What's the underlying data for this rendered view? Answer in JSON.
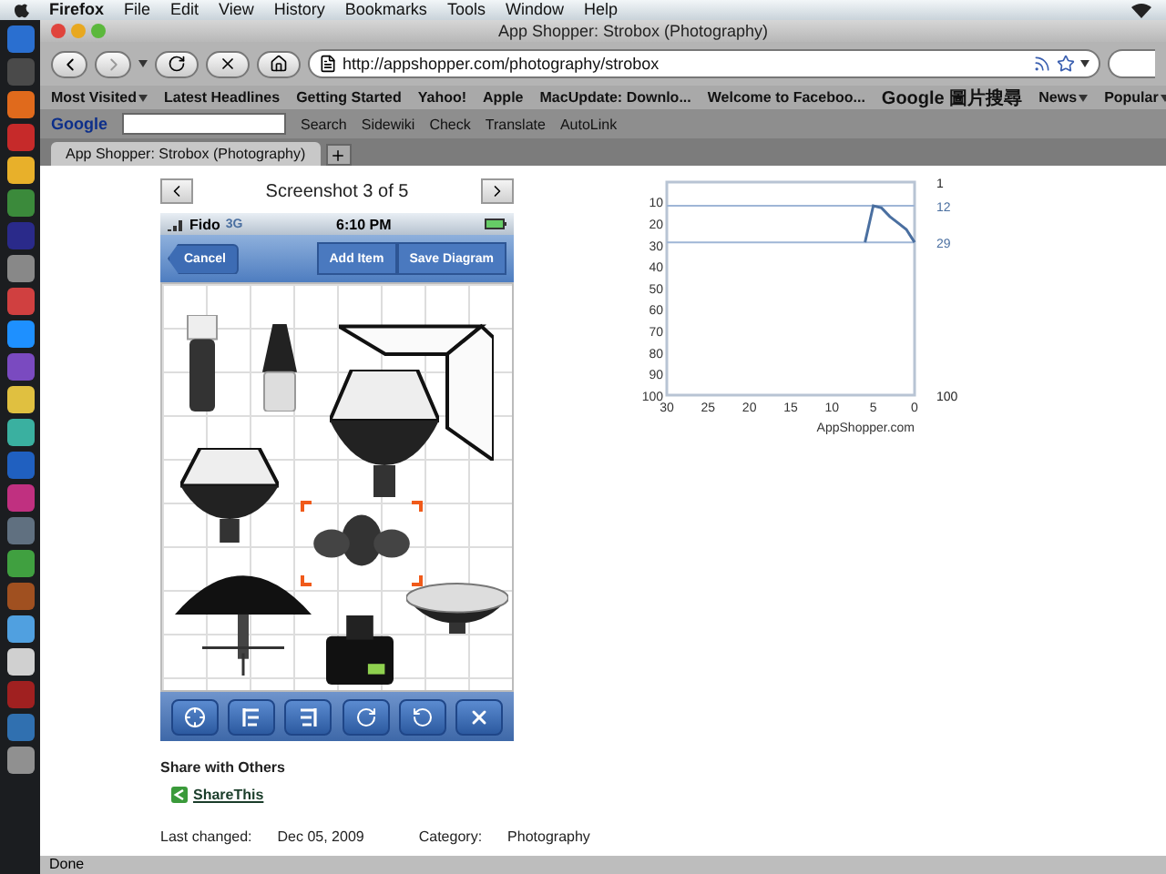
{
  "menu_bar": {
    "app": "Firefox",
    "menus": [
      "File",
      "Edit",
      "View",
      "History",
      "Bookmarks",
      "Tools",
      "Window",
      "Help"
    ]
  },
  "window": {
    "title": "App Shopper: Strobox (Photography)"
  },
  "navigation": {
    "url": "http://appshopper.com/photography/strobox"
  },
  "bookmarks": [
    {
      "label": "Most Visited",
      "has_menu": true
    },
    {
      "label": "Latest Headlines",
      "has_menu": false
    },
    {
      "label": "Getting Started",
      "has_menu": false
    },
    {
      "label": "Yahoo!",
      "has_menu": false
    },
    {
      "label": "Apple",
      "has_menu": false
    },
    {
      "label": "MacUpdate: Downlo...",
      "has_menu": false
    },
    {
      "label": "Welcome to Faceboo...",
      "has_menu": false
    },
    {
      "label": "Google 圖片搜尋",
      "has_menu": false
    },
    {
      "label": "News",
      "has_menu": true
    },
    {
      "label": "Popular",
      "has_menu": true
    }
  ],
  "google_toolbar": {
    "logo": "Google",
    "items": [
      "Search",
      "Sidewiki",
      "Check",
      "Translate",
      "AutoLink"
    ]
  },
  "tabs": [
    {
      "label": "App Shopper: Strobox (Photography)",
      "selected": true
    }
  ],
  "screenshot_viewer": {
    "caption": "Screenshot 3 of 5"
  },
  "phone": {
    "carrier": "Fido",
    "network": "3G",
    "time": "6:10 PM",
    "back_button": "Cancel",
    "actions": [
      "Add Item",
      "Save Diagram"
    ],
    "diagram_items": [
      {
        "kind": "flash",
        "selected": false
      },
      {
        "kind": "snoot",
        "selected": false
      },
      {
        "kind": "softbox",
        "selected": false
      },
      {
        "kind": "hooded-light",
        "selected": false
      },
      {
        "kind": "hooded-light",
        "selected": false
      },
      {
        "kind": "top-light",
        "selected": true
      },
      {
        "kind": "umbrella",
        "selected": false
      },
      {
        "kind": "camera",
        "selected": false
      },
      {
        "kind": "beauty-dish",
        "selected": false
      }
    ],
    "tools": [
      {
        "kind": "target"
      },
      {
        "kind": "align-right"
      },
      {
        "kind": "align-left"
      },
      {
        "kind": "rotate-right"
      },
      {
        "kind": "rotate-left"
      },
      {
        "kind": "delete"
      }
    ]
  },
  "share": {
    "heading": "Share with Others",
    "link": "ShareThis"
  },
  "details": [
    {
      "label": "Last changed:",
      "value": "Dec 05, 2009"
    },
    {
      "label": "Category:",
      "value": "Photography"
    }
  ],
  "rank_chart": {
    "right_labels": [
      "1",
      "12",
      "29",
      "100"
    ],
    "chart_data": {
      "type": "line",
      "xlabel": "AppShopper.com",
      "x": [
        30,
        6,
        5,
        4,
        3,
        2,
        1,
        0
      ],
      "series": [
        {
          "color": "#4a6fa0",
          "values": [
            null,
            29,
            12,
            13,
            17,
            20,
            23,
            29
          ]
        },
        {
          "color": "#9fb6d6",
          "values": [
            12,
            12,
            12,
            12,
            12,
            12,
            12,
            12
          ]
        },
        {
          "color": "#9fb6d6",
          "values": [
            29,
            29,
            29,
            29,
            29,
            29,
            29,
            29
          ]
        }
      ],
      "xlim": [
        30,
        0
      ],
      "ylim": [
        100,
        1
      ],
      "xticks": [
        30,
        25,
        20,
        15,
        10,
        5,
        0
      ],
      "yticks": [
        10,
        20,
        30,
        40,
        50,
        60,
        70,
        80,
        90,
        100
      ]
    }
  },
  "status_bar": {
    "text": "Done"
  }
}
